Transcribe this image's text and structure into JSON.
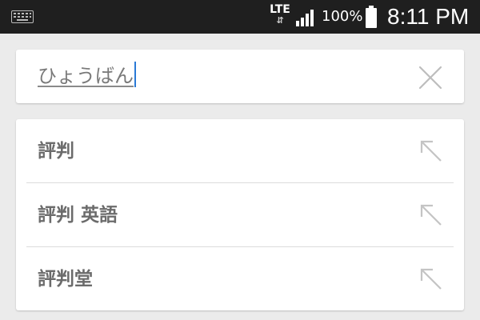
{
  "status_bar": {
    "network_type": "LTE",
    "data_arrows": "⇵",
    "battery_percent": "100%",
    "time": "8:11 PM",
    "icons": [
      "keyboard-icon",
      "signal-icon",
      "battery-icon"
    ]
  },
  "search": {
    "query": "ひょうばん",
    "clear_icon": "close-icon"
  },
  "suggestions": [
    {
      "label": "評判",
      "icon": "arrow-up-left-icon"
    },
    {
      "label": "評判 英語",
      "icon": "arrow-up-left-icon"
    },
    {
      "label": "評判堂",
      "icon": "arrow-up-left-icon"
    }
  ],
  "colors": {
    "status_bar_bg": "#1f1f1f",
    "page_bg": "#ebebeb",
    "card_bg": "#ffffff",
    "cursor": "#2a7ad6",
    "suggestion_text": "#6b6b6b",
    "icon_gray": "#bdbdbd"
  }
}
